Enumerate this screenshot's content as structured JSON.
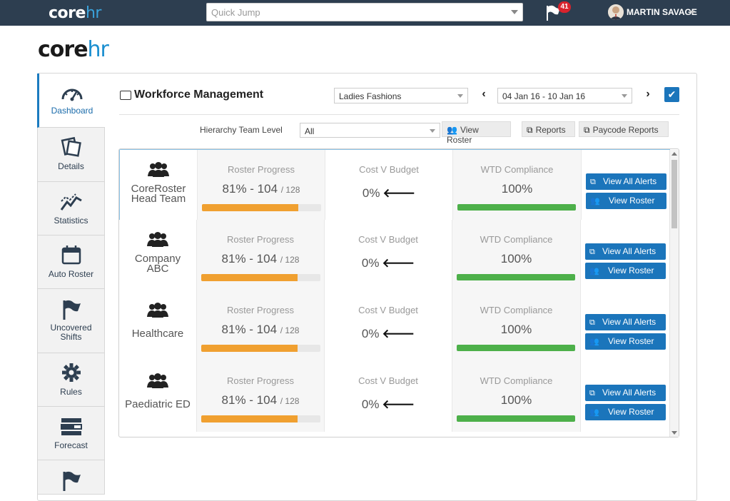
{
  "topbar": {
    "logo_a": "core",
    "logo_b": "hr",
    "quick_jump_placeholder": "Quick Jump",
    "notification_count": "41",
    "user_name": "MARTIN SAVAGE"
  },
  "brand": {
    "a": "core",
    "b": "hr"
  },
  "sidebar": {
    "items": [
      {
        "label": "Dashboard",
        "icon": "gauge-icon"
      },
      {
        "label": "Details",
        "icon": "cards-icon"
      },
      {
        "label": "Statistics",
        "icon": "chart-line-icon"
      },
      {
        "label": "Auto Roster",
        "icon": "calendar-icon"
      },
      {
        "label": "Uncovered Shifts",
        "icon": "flag-icon"
      },
      {
        "label": "Rules",
        "icon": "gear-icon"
      },
      {
        "label": "Forecast",
        "icon": "forecast-icon"
      },
      {
        "label": "",
        "icon": "flag-icon"
      }
    ]
  },
  "header": {
    "title": "Workforce Management",
    "department": "Ladies Fashions",
    "date_range": "04 Jan 16 - 10 Jan 16",
    "prev": "‹",
    "next": "›",
    "confirm": "✔"
  },
  "filters": {
    "hierarchy_label": "Hierarchy Team Level",
    "hierarchy_value": "All",
    "view_roster": "View Roster",
    "reports": "Reports",
    "paycode_reports": "Paycode Reports"
  },
  "labels": {
    "roster_progress": "Roster Progress",
    "cost_v_budget": "Cost V Budget",
    "wtd_compliance": "WTD Compliance",
    "view_all_alerts": "View All Alerts",
    "view_roster": "View Roster",
    "arrow": "🡐"
  },
  "rows": [
    {
      "team_line1": "CoreRoster",
      "team_line2": "Head Team",
      "roster_pct": "81% - 104",
      "roster_total": "/ 128",
      "roster_fill": 0.81,
      "cost": "0%",
      "wtd": "100%"
    },
    {
      "team_line1": "Company",
      "team_line2": "ABC",
      "roster_pct": "81% - 104",
      "roster_total": "/ 128",
      "roster_fill": 0.81,
      "cost": "0%",
      "wtd": "100%"
    },
    {
      "team_line1": "Healthcare",
      "team_line2": "",
      "roster_pct": "81% - 104",
      "roster_total": "/ 128",
      "roster_fill": 0.81,
      "cost": "0%",
      "wtd": "100%"
    },
    {
      "team_line1": "Paediatric ED",
      "team_line2": "",
      "roster_pct": "81% - 104",
      "roster_total": "/ 128",
      "roster_fill": 0.81,
      "cost": "0%",
      "wtd": "100%"
    }
  ],
  "colors": {
    "topbar": "#2d3e50",
    "accent": "#1b75bb",
    "progress": "#f0a030",
    "compliance": "#4db04a"
  }
}
